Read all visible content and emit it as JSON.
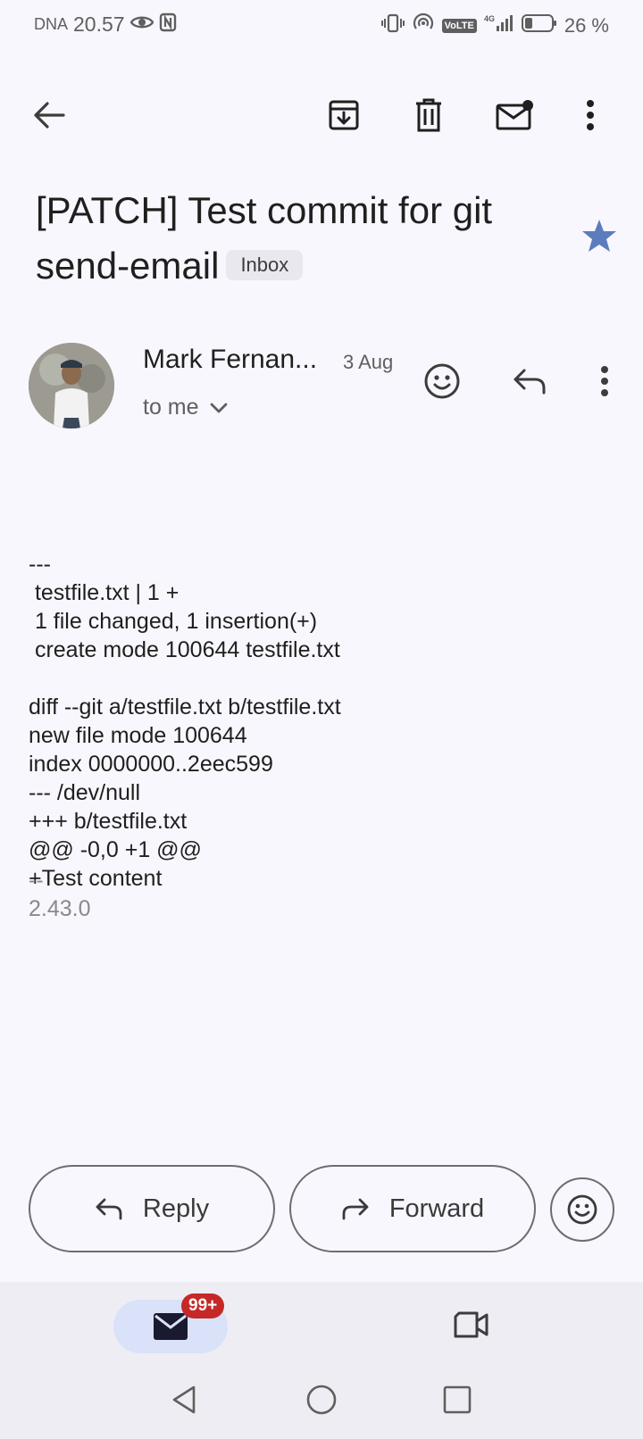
{
  "status_bar": {
    "carrier": "DNA",
    "time": "20.57",
    "battery": "26 %",
    "volte": "VoLTE",
    "network": "4G"
  },
  "email": {
    "subject": "[PATCH] Test commit for git send-email",
    "label": "Inbox",
    "starred": true,
    "star_color": "#5b7dbd",
    "sender": "Mark Fernan...",
    "date": "3 Aug",
    "recipient": "to me",
    "body_lines": [
      "---",
      " testfile.txt | 1 +",
      " 1 file changed, 1 insertion(+)",
      " create mode 100644 testfile.txt",
      "",
      "diff --git a/testfile.txt b/testfile.txt",
      "new file mode 100644",
      "index 0000000..2eec599",
      "--- /dev/null",
      "+++ b/testfile.txt",
      "@@ -0,0 +1 @@",
      "+Test content"
    ],
    "signature": "--\n2.43.0"
  },
  "actions": {
    "reply_label": "Reply",
    "forward_label": "Forward"
  },
  "bottom_nav": {
    "mail_badge": "99+"
  }
}
